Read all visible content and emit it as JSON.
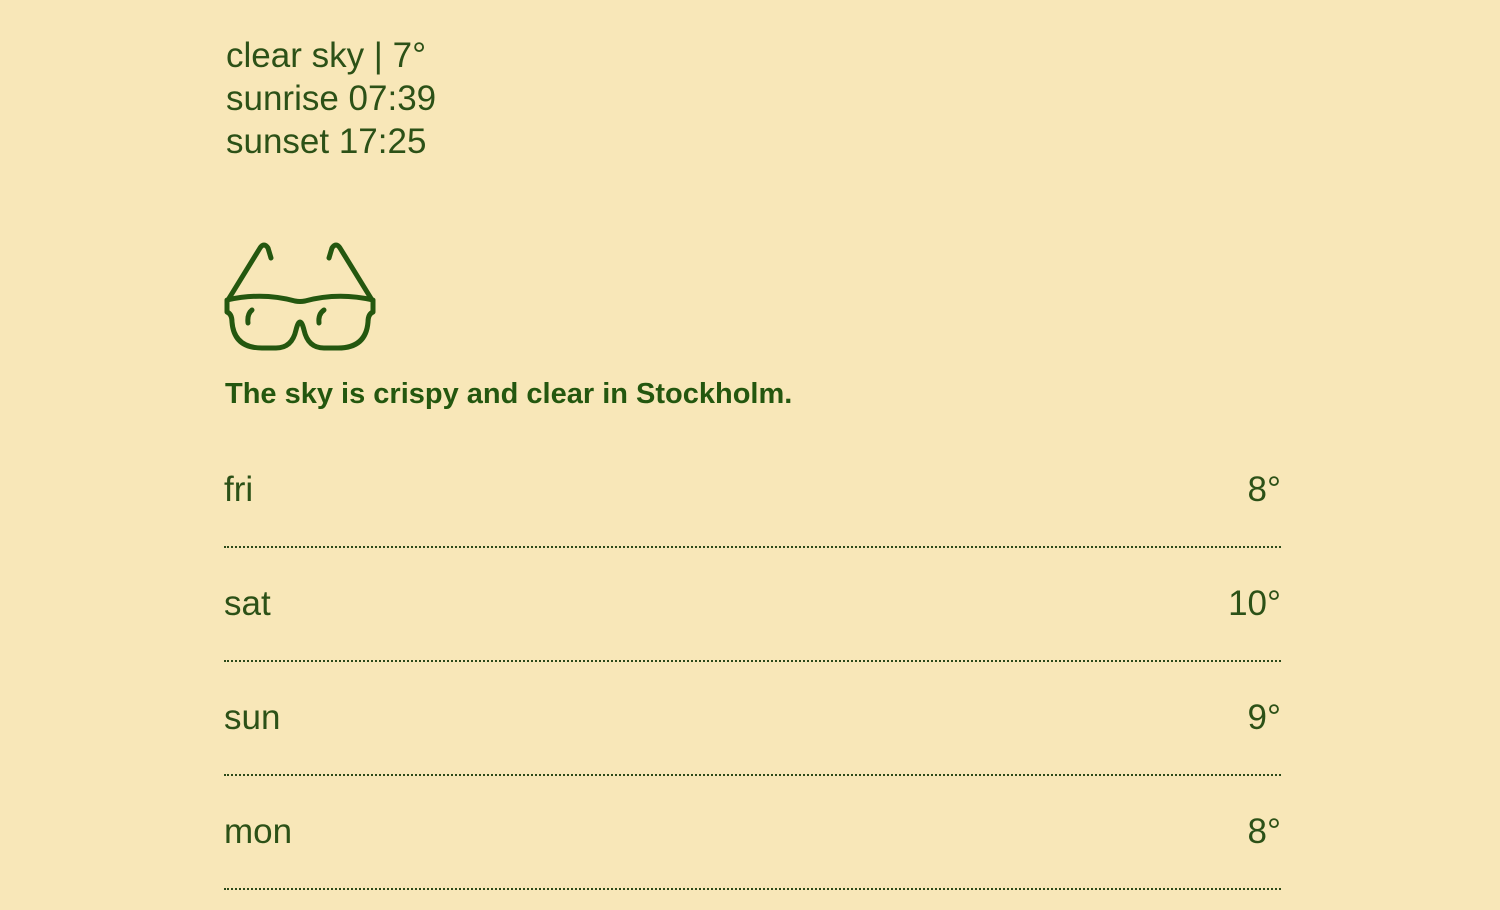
{
  "current": {
    "summary": "clear sky | 7°",
    "sunrise": "sunrise 07:39",
    "sunset": "sunset 17:25"
  },
  "weather_icon": "sunglasses-icon",
  "message": "The sky is crispy and clear in Stockholm.",
  "forecast": [
    {
      "day": "fri",
      "temp": "8°"
    },
    {
      "day": "sat",
      "temp": "10°"
    },
    {
      "day": "sun",
      "temp": "9°"
    },
    {
      "day": "mon",
      "temp": "8°"
    }
  ],
  "colors": {
    "background": "#f8e7b8",
    "text": "#2c5117",
    "accent": "#24570f"
  }
}
